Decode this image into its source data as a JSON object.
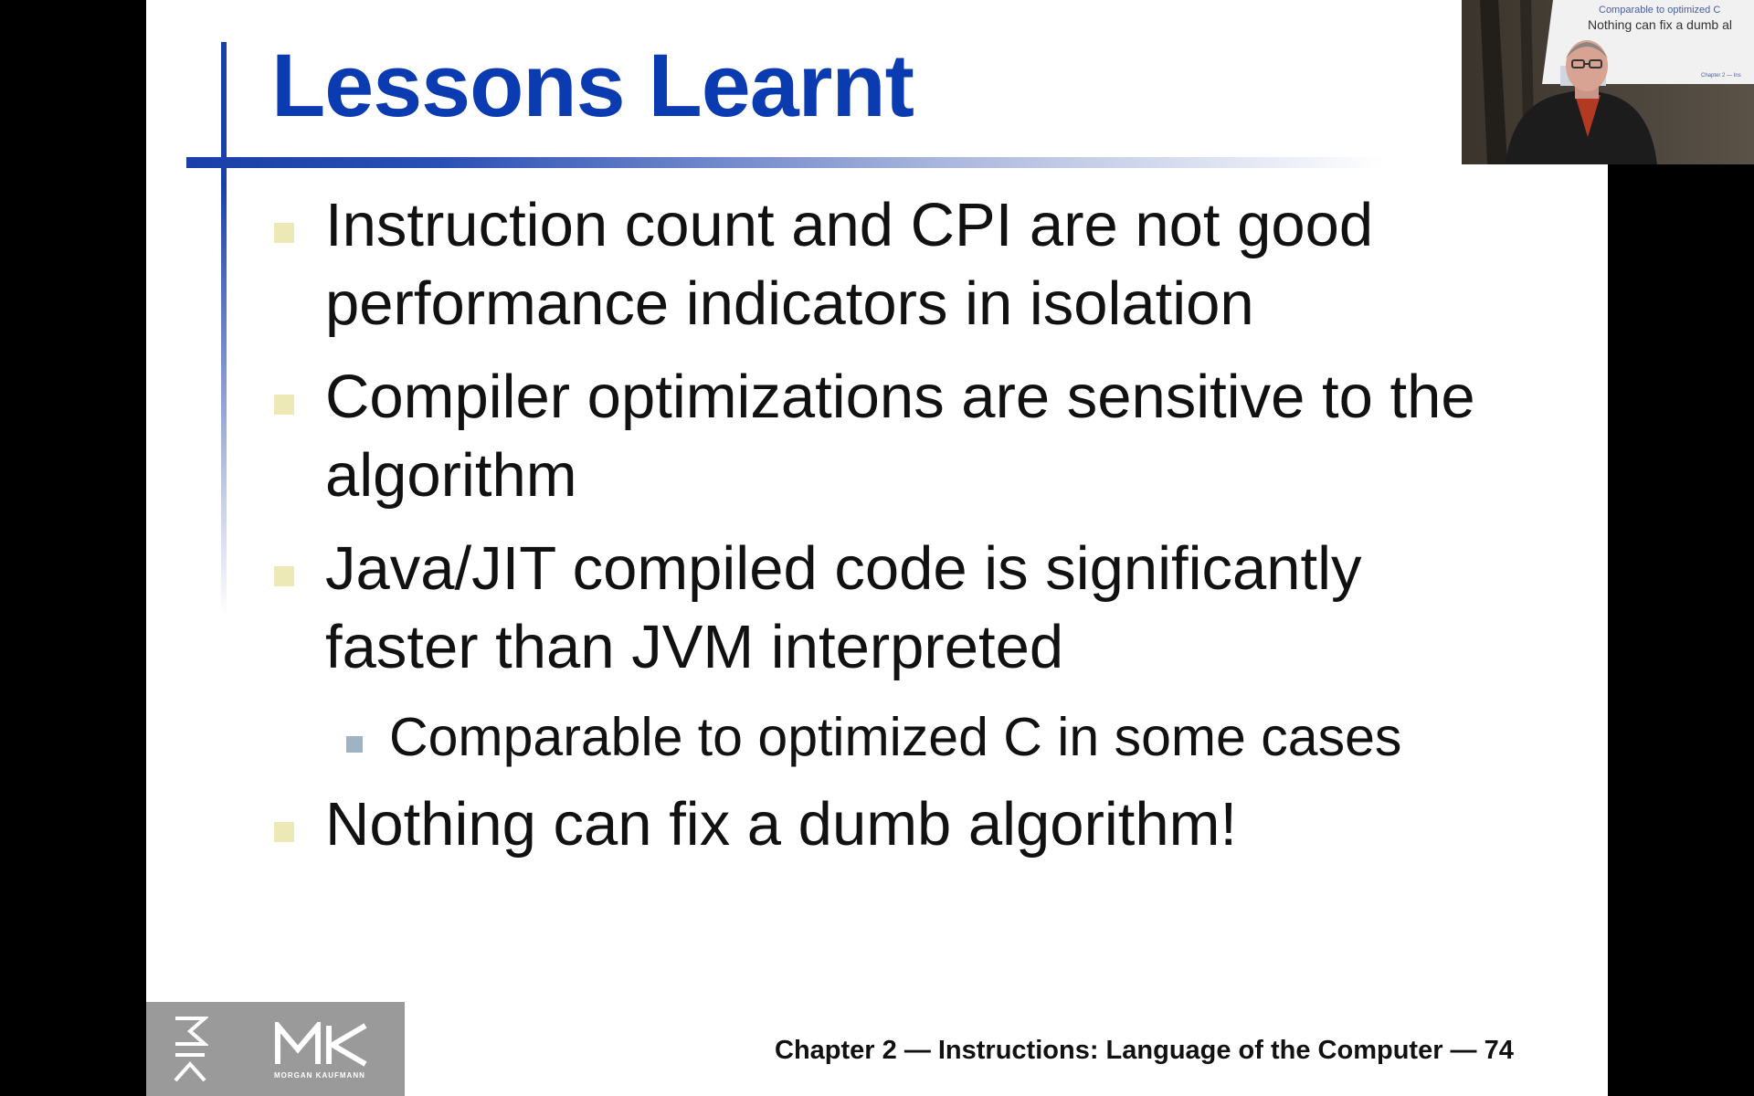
{
  "slide": {
    "title": "Lessons Learnt",
    "bullets": [
      {
        "lines": [
          "Instruction count and CPI are not good",
          "performance indicators in isolation"
        ]
      },
      {
        "lines": [
          "Compiler optimizations are sensitive to the",
          "algorithm"
        ]
      },
      {
        "lines": [
          "Java/JIT compiled code is significantly",
          "faster than JVM interpreted"
        ]
      },
      {
        "sub": "Comparable to optimized C in some cases"
      },
      {
        "lines": [
          "Nothing can fix a dumb algorithm!"
        ]
      }
    ],
    "footer": "Chapter 2 — Instructions: Language of the Computer — 74"
  },
  "logo": {
    "side": "MK",
    "main": "MK",
    "subtitle": "MORGAN KAUFMANN"
  },
  "webcam": {
    "projected_text": [
      "Comparable to optimized C",
      "Nothing can fix a dumb al"
    ],
    "projected_footer": "Chapter 2 — Ins"
  },
  "colors": {
    "title": "#0b3bb0",
    "bullet_marker": "#ede9b6",
    "sub_marker": "#9fb3c3",
    "logo_bg": "#9a9a9a"
  }
}
